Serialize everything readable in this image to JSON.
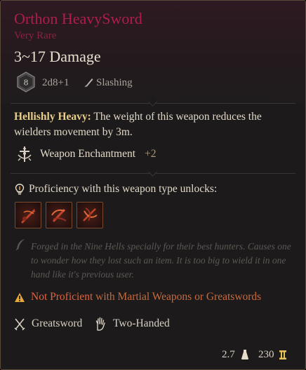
{
  "item": {
    "name": "Orthon HeavySword",
    "rarity": "Very Rare",
    "damage": "3~17 Damage",
    "dice_value": "8",
    "dice_formula": "2d8+1",
    "damage_type": "Slashing"
  },
  "passive": {
    "name": "Hellishly Heavy:",
    "text": " The weight of this weapon reduces the wielders movement by 3m."
  },
  "enchantment": {
    "label": "Weapon Enchantment",
    "value": "+2"
  },
  "proficiency": {
    "label": "Proficiency with this weapon type unlocks:",
    "actions": [
      "action-1",
      "action-2",
      "action-3"
    ]
  },
  "flavor_text": "Forged in the Nine Hells specially for their best hunters. Causes one to wonder how they lost such an item. It is too big to wield it in one hand like it's previous user.",
  "warning": {
    "prefix": "Not Proficient",
    "rest": " with Martial Weapons or Greatswords"
  },
  "properties": {
    "weapon_type": "Greatsword",
    "handedness": "Two-Handed"
  },
  "footer": {
    "weight": "2.7",
    "price": "230"
  },
  "colors": {
    "name": "#b01d4d",
    "rarity": "#8c2343",
    "passive_title": "#e8cf8a",
    "warning": "#e2633f",
    "price_icon": "#e8c058"
  },
  "icons": [
    "d8-dice-icon",
    "slash-icon",
    "enchantment-icon",
    "lightbulb-icon",
    "quill-icon",
    "warning-icon",
    "crossed-swords-icon",
    "hand-icon",
    "weight-icon",
    "gold-coin-icon"
  ]
}
